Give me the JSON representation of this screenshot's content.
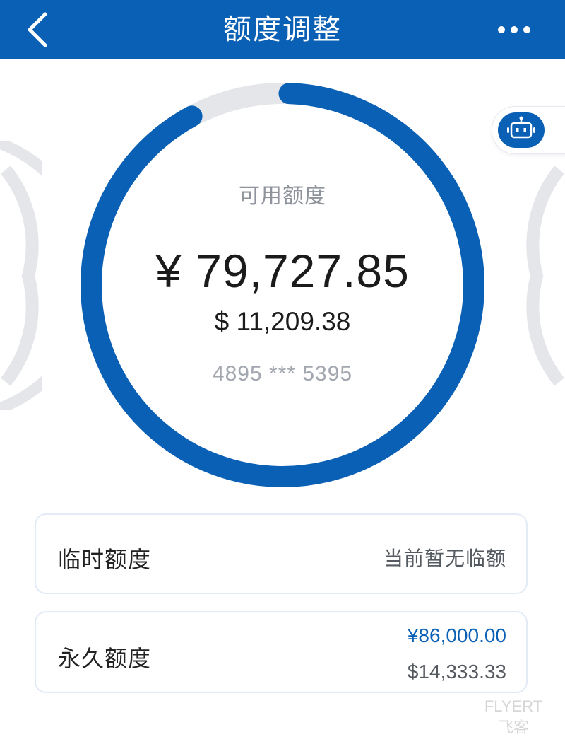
{
  "header": {
    "title": "额度调整",
    "back_icon": "chevron-left-icon",
    "more_icon": "more-horizontal-icon"
  },
  "assistant": {
    "icon": "robot-icon"
  },
  "credit_ring": {
    "label": "可用额度",
    "available_cny": "¥ 79,727.85",
    "available_usd": "$ 11,209.38",
    "card_number": "4895 *** 5395",
    "used_fraction": 0.073
  },
  "limits": {
    "temporary": {
      "label": "临时额度",
      "value": "当前暂无临额"
    },
    "permanent": {
      "label": "永久额度",
      "value_cny": "¥86,000.00",
      "value_usd": "$14,333.33"
    }
  },
  "watermark": {
    "line1": "FLYERT",
    "line2": "飞客"
  },
  "colors": {
    "brand": "#0a60b5",
    "track": "#e4e6ea",
    "muted_text": "#8e939c"
  }
}
